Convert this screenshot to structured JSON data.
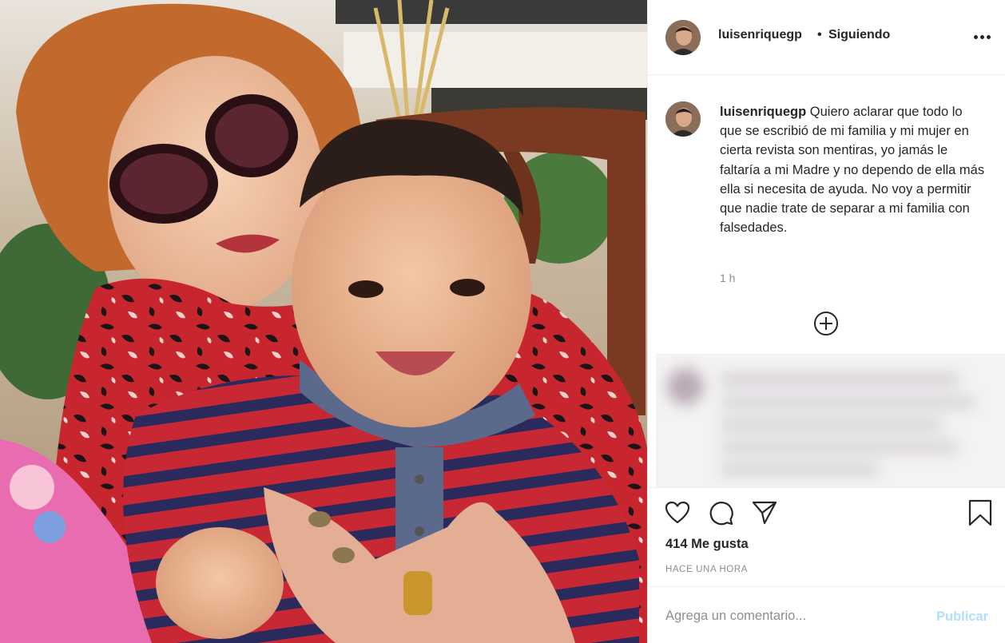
{
  "header": {
    "username": "luisenriquegp",
    "separator": "•",
    "follow_status": "Siguiendo"
  },
  "caption": {
    "username": "luisenriquegp",
    "text": "Quiero aclarar que todo lo que se escribió de mi familia y mi mujer en cierta revista son mentiras, yo jamás le faltaría a mi Madre y no dependo de ella más ella si necesita de ayuda. No voy a permitir que nadie trate de separar a mi familia con falsedades.",
    "time": "1 h"
  },
  "actions": {
    "likes": "414 Me gusta",
    "timestamp": "HACE UNA HORA",
    "icons": [
      "heart-icon",
      "comment-icon",
      "share-icon",
      "bookmark-icon"
    ]
  },
  "comment_box": {
    "placeholder": "Agrega un comentario...",
    "submit_label": "Publicar"
  },
  "colors": {
    "text": "#262626",
    "secondary": "#8e8e8e",
    "publish_disabled": "#b2dffc",
    "border": "#efefef"
  }
}
